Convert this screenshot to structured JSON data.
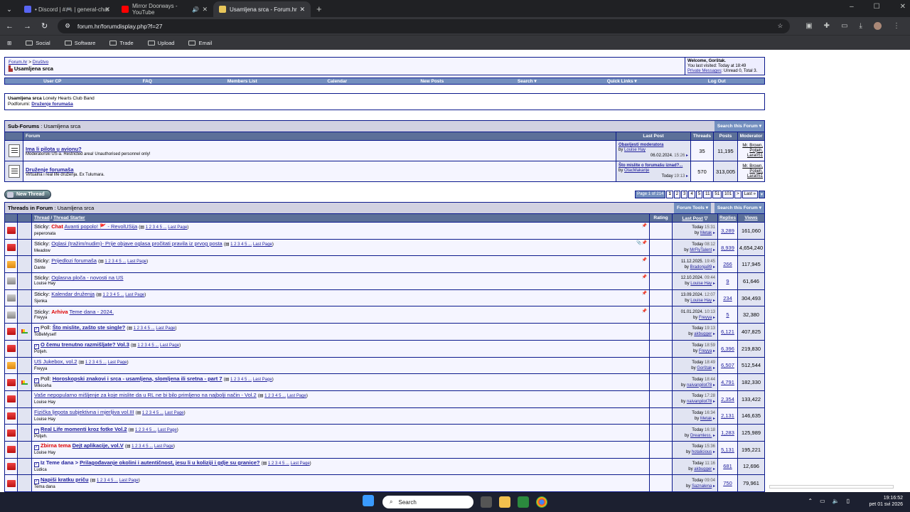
{
  "browser": {
    "tabs": [
      {
        "label": "• Discord | #🎮 | general-chat",
        "fav_color": "#5865f2"
      },
      {
        "label": "Mirror Doorways - YouTube",
        "fav_color": "#ff0000",
        "audio": "🔊"
      },
      {
        "label": "Usamljena srca - Forum.hr",
        "fav_color": "#e8c65a",
        "active": true
      }
    ],
    "new_tab": "+",
    "url": "forum.hr/forumdisplay.php?f=27",
    "bookmarks": [
      "Social",
      "Software",
      "Trade",
      "Upload",
      "Email"
    ],
    "window_controls": [
      "–",
      "☐",
      "✕"
    ]
  },
  "forum": {
    "breadcrumb_root": "Forum.hr",
    "breadcrumb_sep": ">",
    "breadcrumb_parent": "Društvo",
    "current_forum": "Usamljena srca",
    "welcome": "Welcome, Gorštak.",
    "last_visited": "You last visited: Today at 18:49",
    "pm_label": "Private Messages",
    "pm_counts": ": Unread 0, Total 3.",
    "menu": [
      "User CP",
      "FAQ",
      "Members List",
      "Calendar",
      "New Posts",
      "Search ▾",
      "Quick Links ▾",
      "Log Out"
    ],
    "desc_title": "Usamljena srca",
    "desc_sub": "Lonely Hearts Club Band",
    "subforums_label": "Podforumi:",
    "subforums_link": "Druženje forumaša",
    "subforums_header_bold": "Sub-Forums",
    "subforums_header_rest": ": Usamljena srca",
    "search_this_forum": "Search this Forum ▾",
    "sub_cols": [
      "Forum",
      "Last Post",
      "Threads",
      "Posts",
      "Moderator"
    ],
    "subforums": [
      {
        "title": "Ima li pilota u avionu?",
        "desc": "Moderatorski US-a. Restricted area! Unauthorised personnel only!",
        "lp_title": "Obavijesti moderatora",
        "lp_by": "Louise Hay",
        "lp_date": "06.02.2024.",
        "lp_time": "15:26",
        "threads": "35",
        "posts": "11,195",
        "mods": [
          "Mr. Brown,",
          "Potjeh,",
          "Lara051"
        ]
      },
      {
        "title": "Druženje forumaša",
        "desc": "Virtualna i real life druženja. Ex Tulumara.",
        "lp_title": "Što mislite o forumašu iznad?...",
        "lp_by": "OtacMakarije",
        "lp_date": "Today",
        "lp_time": "19:13",
        "threads": "570",
        "posts": "313,005",
        "mods": [
          "Mr. Brown,",
          "Potjeh,",
          "Lara051"
        ]
      }
    ],
    "new_thread": "New Thread",
    "pager": {
      "label": "Page 1 of 214",
      "pages": [
        "1",
        "2",
        "3",
        "4",
        "5",
        "11",
        "51",
        "101",
        ">",
        "Last »",
        "▾"
      ]
    },
    "threads_header_bold": "Threads in Forum",
    "threads_header_rest": ": Usamljena srca",
    "forum_tools": "Forum Tools ▾",
    "thread_cols": {
      "thread": "Thread",
      "sep": "/",
      "starter": "Thread Starter",
      "rating": "Rating",
      "last_post": "Last Post",
      "replies": "Replies",
      "views": "Views"
    },
    "threads": [
      {
        "icon": "red",
        "prefix": "Sticky:",
        "tag": "Chat",
        "title": "Avanti popolo! 🚩 - RevolUSija",
        "pages": "1 2 3 4 5 ...",
        "last_page": "Last Page",
        "starter": "peperonata",
        "date": "Today",
        "time": "15:31",
        "by": "Metak",
        "replies": "3,289",
        "views": "161,060",
        "bold": false,
        "chk": false,
        "pin": "📌"
      },
      {
        "icon": "red",
        "prefix": "Sticky:",
        "tag": "",
        "title": "Oglasi (tražim/nudim)- Prije objave oglasa pročitati pravila iz prvog posta",
        "pages": "1 2 3 4 5 ...",
        "last_page": "Last Page",
        "starter": "Meadow",
        "date": "Today",
        "time": "08:12",
        "by": "MrFlyTalent",
        "replies": "8,939",
        "views": "4,654,240",
        "bold": false,
        "chk": false,
        "pin": "📎📌"
      },
      {
        "icon": "yel",
        "prefix": "Sticky:",
        "tag": "",
        "title": "Prijedlozi forumaša",
        "pages": "1 2 3 4 5 ...",
        "last_page": "Last Page",
        "starter": "Dante",
        "date": "11.12.2025.",
        "time": "19:45",
        "by": "Bradonja89",
        "replies": "266",
        "views": "117,945",
        "bold": false,
        "chk": false,
        "pin": "📌"
      },
      {
        "icon": "gry",
        "prefix": "Sticky:",
        "tag": "",
        "title": "Oglasna ploča - novosti na US",
        "pages": "",
        "last_page": "",
        "starter": "Louise Hay",
        "date": "12.10.2024.",
        "time": "09:44",
        "by": "Louise Hay",
        "replies": "9",
        "views": "61,646",
        "bold": false,
        "chk": false,
        "pin": "📌"
      },
      {
        "icon": "gry",
        "prefix": "Sticky:",
        "tag": "",
        "title": "Kalendar druženja",
        "pages": "1 2 3 4 5 ...",
        "last_page": "Last Page",
        "starter": "Sjenka",
        "date": "13.09.2024.",
        "time": "12:07",
        "by": "Louise Hay",
        "replies": "234",
        "views": "304,493",
        "bold": false,
        "chk": false,
        "pin": "📌"
      },
      {
        "icon": "gry",
        "prefix": "Sticky:",
        "tag": "Arhiva",
        "title": "Teme dana - 2024.",
        "pages": "",
        "last_page": "",
        "starter": "Freyya",
        "date": "01.01.2024.",
        "time": "10:13",
        "by": "Freyya",
        "replies": "5",
        "views": "32,380",
        "bold": false,
        "chk": false,
        "pin": "📌"
      },
      {
        "icon": "red",
        "prefix": "Poll:",
        "tag": "",
        "title": "Što mislite, zašto ste single?",
        "pages": "1 2 3 4 5 ...",
        "last_page": "Last Page",
        "starter": "ToBeMyself",
        "date": "Today",
        "time": "19:13",
        "by": "akbugger",
        "replies": "6,121",
        "views": "407,825",
        "bold": true,
        "chk": true,
        "pin": ""
      },
      {
        "icon": "red",
        "prefix": "",
        "tag": "",
        "title": "O čemu trenutno razmišljate? Vol.3",
        "pages": "1 2 3 4 5 ...",
        "last_page": "Last Page",
        "starter": "Potjeh.",
        "date": "Today",
        "time": "18:59",
        "by": "Freyya",
        "replies": "6,396",
        "views": "219,830",
        "bold": true,
        "chk": true,
        "pin": ""
      },
      {
        "icon": "yel",
        "prefix": "",
        "tag": "",
        "title": "US Jukebox, vol.2",
        "pages": "1 2 3 4 5 ...",
        "last_page": "Last Page",
        "starter": "Freyya",
        "date": "Today",
        "time": "18:49",
        "by": "Gorštak",
        "replies": "6,507",
        "views": "512,544",
        "bold": false,
        "chk": false,
        "pin": ""
      },
      {
        "icon": "red",
        "prefix": "Poll:",
        "tag": "",
        "title": "Horoskopski znakovi i srca - usamljena, slomljena ili sretna - part 7",
        "pages": "1 2 3 4 5 ...",
        "last_page": "Last Page",
        "starter": "Wikiceha",
        "date": "Today",
        "time": "18:44",
        "by": "naivanpilot78",
        "replies": "4,791",
        "views": "182,330",
        "bold": true,
        "chk": true,
        "pin": ""
      },
      {
        "icon": "red",
        "prefix": "",
        "tag": "",
        "title": "Vaše nepopularno mišljenje za koje mislite da u RL ne bi bilo primljeno na najbolji način - Vol.2",
        "pages": "1 2 3 4 5 ...",
        "last_page": "Last Page",
        "starter": "Louise Hay",
        "date": "Today",
        "time": "17:28",
        "by": "naivanpilot78",
        "replies": "2,354",
        "views": "133,422",
        "bold": false,
        "chk": false,
        "pin": ""
      },
      {
        "icon": "red",
        "prefix": "",
        "tag": "",
        "title": "Fizička ljepota subjektivna i mjerljiva vol.III",
        "pages": "1 2 3 4 5 ...",
        "last_page": "Last Page",
        "starter": "Louise Hay",
        "date": "Today",
        "time": "16:34",
        "by": "Metak",
        "replies": "2,131",
        "views": "146,635",
        "bold": false,
        "chk": false,
        "pin": ""
      },
      {
        "icon": "red",
        "prefix": "",
        "tag": "",
        "title": "Real Life momenti kroz fotke Vol.2",
        "pages": "1 2 3 4 5 ...",
        "last_page": "Last Page",
        "starter": "Potjeh.",
        "date": "Today",
        "time": "16:18",
        "by": "Dreamless.",
        "replies": "1,283",
        "views": "125,989",
        "bold": true,
        "chk": true,
        "pin": ""
      },
      {
        "icon": "red",
        "prefix": "",
        "tag": "Zbirna tema",
        "title": "Dejt aplikacije, vol.V",
        "pages": "1 2 3 4 5 ...",
        "last_page": "Last Page",
        "starter": "Louise Hay",
        "date": "Today",
        "time": "15:36",
        "by": "hotalicious",
        "replies": "5,131",
        "views": "195,221",
        "bold": true,
        "chk": true,
        "pin": ""
      },
      {
        "icon": "red",
        "prefix": "",
        "tag": "Iz Teme dana >",
        "title": "Prilagođavanje okolini i autentičnost, jesu li u koliziji i gdje su granice?",
        "pages": "1 2 3 4 5 ...",
        "last_page": "Last Page",
        "starter": "Ludica",
        "date": "Today",
        "time": "11:16",
        "by": "akbugger",
        "replies": "681",
        "views": "12,696",
        "bold": true,
        "chk": true,
        "pin": ""
      },
      {
        "icon": "red",
        "prefix": "",
        "tag": "",
        "title": "Napiši kratku priču",
        "pages": "1 2 3 4 5 ...",
        "last_page": "Last Page",
        "starter": "Tema dana",
        "date": "Today",
        "time": "09:04",
        "by": "Saznalena",
        "replies": "750",
        "views": "79,961",
        "bold": true,
        "chk": true,
        "pin": ""
      }
    ]
  },
  "taskbar": {
    "search": "Search",
    "time": "19:16:52",
    "date": "pet 01 svi 2026"
  }
}
